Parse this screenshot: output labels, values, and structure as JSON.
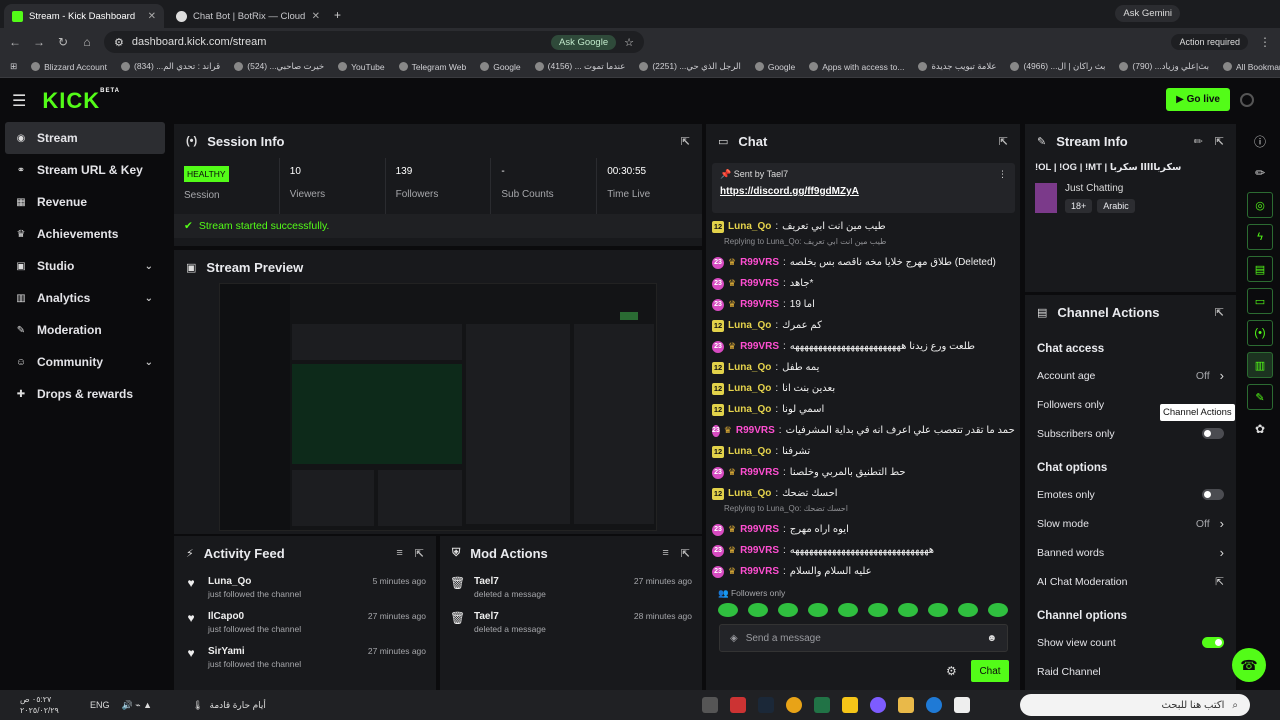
{
  "browser": {
    "tabs": [
      {
        "title": "Stream - Kick Dashboard",
        "active": true
      },
      {
        "title": "Chat Bot | BotRix — Cloud Strea",
        "active": false
      }
    ],
    "url": "dashboard.kick.com/stream",
    "ask_google": "Ask Google",
    "ask_gemini": "Ask Gemini",
    "action_required": "Action required",
    "bookmarks": [
      "Blizzard Account",
      "قراند : تحدي الم... (834)",
      "خيرت صاحبي... (524)",
      "YouTube",
      "Telegram Web",
      "Google",
      "عندما تموت ... (4156)",
      "الرجل الذي حي... (2251)",
      "Google",
      "Apps with access to...",
      "علامة تبويب جديدة",
      "بث راكان | ال... (4966)",
      "بث|علي وزياد... (790)",
      "All Bookmarks"
    ]
  },
  "app": {
    "logo": "KICK",
    "logo_sup": "BETA",
    "go_live": "Go live"
  },
  "sidebar": {
    "items": [
      {
        "label": "Stream",
        "icon": "stream-icon",
        "glyph": "◉",
        "active": true,
        "chevron": false
      },
      {
        "label": "Stream URL & Key",
        "icon": "link-icon",
        "glyph": "⚭",
        "active": false,
        "chevron": false
      },
      {
        "label": "Revenue",
        "icon": "revenue-icon",
        "glyph": "▦",
        "active": false,
        "chevron": false
      },
      {
        "label": "Achievements",
        "icon": "trophy-icon",
        "glyph": "♛",
        "active": false,
        "chevron": false
      },
      {
        "label": "Studio",
        "icon": "studio-icon",
        "glyph": "▣",
        "active": false,
        "chevron": true
      },
      {
        "label": "Analytics",
        "icon": "analytics-icon",
        "glyph": "▥",
        "active": false,
        "chevron": true
      },
      {
        "label": "Moderation",
        "icon": "wrench-icon",
        "glyph": "✎",
        "active": false,
        "chevron": false
      },
      {
        "label": "Community",
        "icon": "community-icon",
        "glyph": "☺",
        "active": false,
        "chevron": true
      },
      {
        "label": "Drops & rewards",
        "icon": "gift-icon",
        "glyph": "✚",
        "active": false,
        "chevron": false
      }
    ]
  },
  "session": {
    "title": "Session Info",
    "status": "HEALTHY",
    "status_label": "Session",
    "stats": [
      {
        "value": "10",
        "label": "Viewers"
      },
      {
        "value": "139",
        "label": "Followers"
      },
      {
        "value": "-",
        "label": "Sub Counts"
      },
      {
        "value": "00:30:55",
        "label": "Time Live"
      }
    ],
    "success": "Stream started successfully."
  },
  "preview": {
    "title": "Stream Preview"
  },
  "activity": {
    "title": "Activity Feed",
    "items": [
      {
        "name": "Luna_Qo",
        "sub": "just followed the channel",
        "time": "5 minutes ago"
      },
      {
        "name": "IlCapo0",
        "sub": "just followed the channel",
        "time": "27 minutes ago"
      },
      {
        "name": "SirYami",
        "sub": "just followed the channel",
        "time": "27 minutes ago"
      }
    ]
  },
  "mod": {
    "title": "Mod Actions",
    "items": [
      {
        "name": "Tael7",
        "sub": "deleted a message",
        "time": "27 minutes ago"
      },
      {
        "name": "Tael7",
        "sub": "deleted a message",
        "time": "28 minutes ago"
      }
    ]
  },
  "chat": {
    "title": "Chat",
    "pinned_sent_by": "Sent by",
    "pinned_user": "Tael7",
    "pinned_link": "https://discord.gg/ff9gdMZyA",
    "rows": [
      {
        "type": "msg",
        "badge": "12",
        "user": "Luna_Qo",
        "cls": "u-luna",
        "text": "طيب مين انت ابي تعريف"
      },
      {
        "type": "reply",
        "text": "Replying to Luna_Qo: طيب مين انت ابي تعريف"
      },
      {
        "type": "msg",
        "badge": "23",
        "user": "R99VRS",
        "cls": "u-r99",
        "text": "طلاق مهرج خلايا مخه ناقصه بس بخلصه (Deleted)"
      },
      {
        "type": "msg",
        "badge": "23",
        "user": "R99VRS",
        "cls": "u-r99",
        "text": "جاهد*"
      },
      {
        "type": "msg",
        "badge": "23",
        "user": "R99VRS",
        "cls": "u-r99",
        "text": "اما 19"
      },
      {
        "type": "msg",
        "badge": "12",
        "user": "Luna_Qo",
        "cls": "u-luna",
        "text": "كم عمرك"
      },
      {
        "type": "msg",
        "badge": "23",
        "user": "R99VRS",
        "cls": "u-r99",
        "text": "طلعت ورع زيدنا ههههههههههههههههههههههههه"
      },
      {
        "type": "msg",
        "badge": "12",
        "user": "Luna_Qo",
        "cls": "u-luna",
        "text": "يمه طفل"
      },
      {
        "type": "msg",
        "badge": "12",
        "user": "Luna_Qo",
        "cls": "u-luna",
        "text": "بعدين بنت انا"
      },
      {
        "type": "msg",
        "badge": "12",
        "user": "Luna_Qo",
        "cls": "u-luna",
        "text": "اسمي لونا"
      },
      {
        "type": "msg",
        "badge": "23",
        "user": "R99VRS",
        "cls": "u-r99",
        "text": "عاد احمد ما تقدر تتعصب علي اعرف انه في بداية المشرفيات"
      },
      {
        "type": "msg",
        "badge": "12",
        "user": "Luna_Qo",
        "cls": "u-luna",
        "text": "تشرفنا"
      },
      {
        "type": "msg",
        "badge": "23",
        "user": "R99VRS",
        "cls": "u-r99",
        "text": "حط التطنيق بالمربي وخلصنا"
      },
      {
        "type": "msg",
        "badge": "12",
        "user": "Luna_Qo",
        "cls": "u-luna",
        "text": "احسك تضحك"
      },
      {
        "type": "reply",
        "text": "Replying to Luna_Qo: احسك تضحك"
      },
      {
        "type": "msg",
        "badge": "23",
        "user": "R99VRS",
        "cls": "u-r99",
        "text": "ايوه اراه مهرج"
      },
      {
        "type": "msg",
        "badge": "23",
        "user": "R99VRS",
        "cls": "u-r99",
        "text": "ههههههههههههههههههههههههههههههه"
      },
      {
        "type": "msg",
        "badge": "23",
        "user": "R99VRS",
        "cls": "u-r99",
        "text": "عليه السلام والسلام"
      }
    ],
    "followers_only": "Followers only",
    "placeholder": "Send a message",
    "send": "Chat"
  },
  "streaminfo": {
    "title": "Stream Info",
    "stream_title": "!OL | !OG | !MT | سكربااااا سكربا",
    "category": "Just Chatting",
    "tags": [
      "18+",
      "Arabic"
    ]
  },
  "channel": {
    "title": "Channel Actions",
    "sections": [
      {
        "heading": "Chat access",
        "opts": [
          {
            "label": "Account age",
            "value": "Off",
            "kind": "chev"
          },
          {
            "label": "Followers only",
            "value": "",
            "kind": "none"
          },
          {
            "label": "Subscribers only",
            "value": "",
            "kind": "toggle"
          }
        ]
      },
      {
        "heading": "Chat options",
        "opts": [
          {
            "label": "Emotes only",
            "value": "",
            "kind": "toggle"
          },
          {
            "label": "Slow mode",
            "value": "Off",
            "kind": "chev"
          },
          {
            "label": "Banned words",
            "value": "",
            "kind": "chev"
          },
          {
            "label": "AI Chat Moderation",
            "value": "",
            "kind": "ext"
          }
        ]
      },
      {
        "heading": "Channel options",
        "opts": [
          {
            "label": "Show view count",
            "value": "",
            "kind": "toggle-on"
          },
          {
            "label": "Raid Channel",
            "value": "",
            "kind": "none"
          }
        ]
      }
    ]
  },
  "tooltip": "Channel Actions",
  "taskbar": {
    "time": "٠٥:٢٧ ص",
    "date": "٢٠٢٥/٠٢/٢٩",
    "lang": "ENG",
    "weather": "أيام حارة قادمة",
    "search": "اكتب هنا للبحث"
  },
  "colors": {
    "accent": "#53fc18",
    "bg": "#0b0b0d",
    "panel": "#18191c"
  }
}
